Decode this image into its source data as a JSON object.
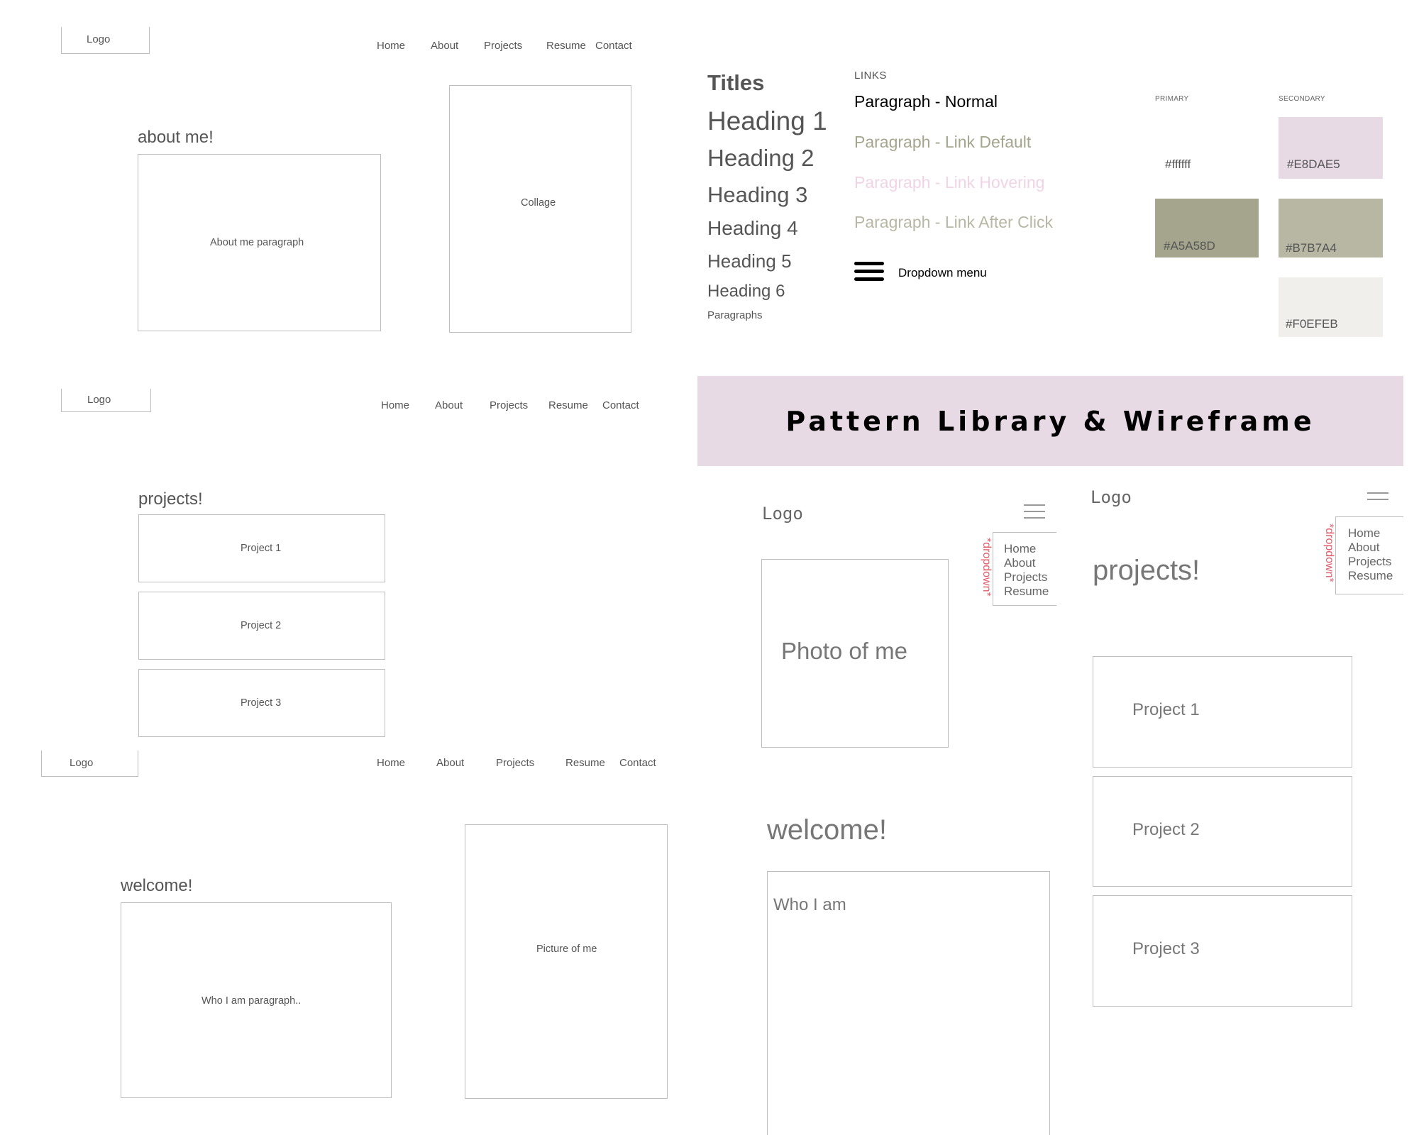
{
  "nav": {
    "home": "Home",
    "about": "About",
    "projects": "Projects",
    "resume": "Resume",
    "contact": "Contact"
  },
  "logo": "Logo",
  "about_page": {
    "title": "about me!",
    "paragraph": "About me paragraph",
    "collage": "Collage"
  },
  "projects_page": {
    "title": "projects!",
    "items": [
      "Project 1",
      "Project 2",
      "Project 3"
    ]
  },
  "welcome_page": {
    "title": "welcome!",
    "paragraph": "Who I am paragraph..",
    "picture": "Picture of me"
  },
  "pattern_library": {
    "titles": "Titles",
    "headings": [
      "Heading 1",
      "Heading 2",
      "Heading 3",
      "Heading 4",
      "Heading 5",
      "Heading 6"
    ],
    "paragraphs": "Paragraphs",
    "links_heading": "LINKS",
    "paragraph_normal": "Paragraph - Normal",
    "link_default": "Paragraph - Link Default",
    "link_hovering": "Paragraph - Link Hovering",
    "link_after_click": "Paragraph - Link After Click",
    "dropdown_menu": "Dropdown menu",
    "palette": {
      "primary_label": "PRIMARY",
      "secondary_label": "SECONDARY",
      "white": "#ffffff",
      "pink": "#E8DAE5",
      "olive": "#A5A58D",
      "sage": "#B7B7A4",
      "offwhite": "#F0EFEB"
    },
    "link_colors": {
      "normal": "#000000",
      "default": "#A5A58D",
      "hover": "#F0D4E6",
      "after": "#B7B7A4"
    }
  },
  "banner": {
    "title": "Pattern Library & Wireframe"
  },
  "mobile": {
    "dropdown_tag": "*dropdown*",
    "menu_items": [
      "Home",
      "About",
      "Projects",
      "Resume"
    ],
    "home": {
      "photo": "Photo of me",
      "title": "welcome!",
      "who": "Who I am"
    },
    "projects": {
      "title": "projects!",
      "items": [
        "Project 1",
        "Project 2",
        "Project 3"
      ]
    }
  }
}
